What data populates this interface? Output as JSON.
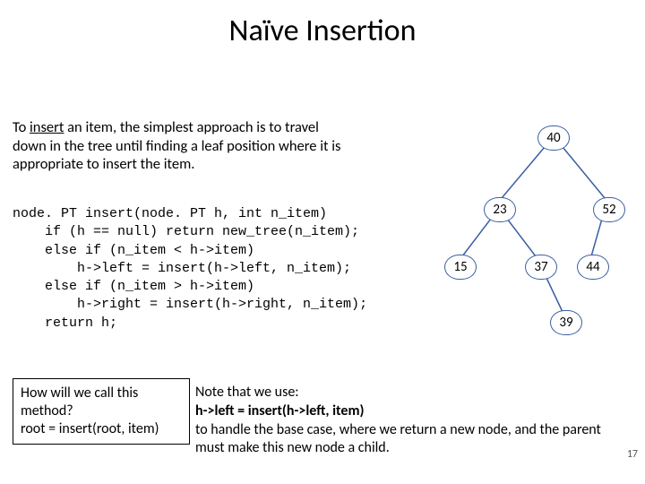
{
  "title": "Naïve Insertion",
  "intro_html": "To <span class='underline'>insert</span> an item, the simplest approach is to travel down in the tree until finding a leaf position where it is appropriate to insert the item.",
  "code": "node. PT insert(node. PT h, int n_item)\n    if (h == null) return new_tree(n_item);\n    else if (n_item < h->item)\n        h->left = insert(h->left, n_item);\n    else if (n_item > h->item)\n        h->right = insert(h->right, n_item);\n    return h;",
  "bottom_left": "How will we call this method?\nroot = insert(root, item)",
  "bottom_right_parts": {
    "line1": "Note that we use:",
    "bold1": "h->left = insert(h->left, item)",
    "rest": "to handle the base case, where we return a new node, and the parent must make this new node a child."
  },
  "slide_number": "17",
  "tree": {
    "nodes": {
      "n40": "40",
      "n23": "23",
      "n52": "52",
      "n15": "15",
      "n37": "37",
      "n44": "44",
      "n39": "39"
    }
  }
}
